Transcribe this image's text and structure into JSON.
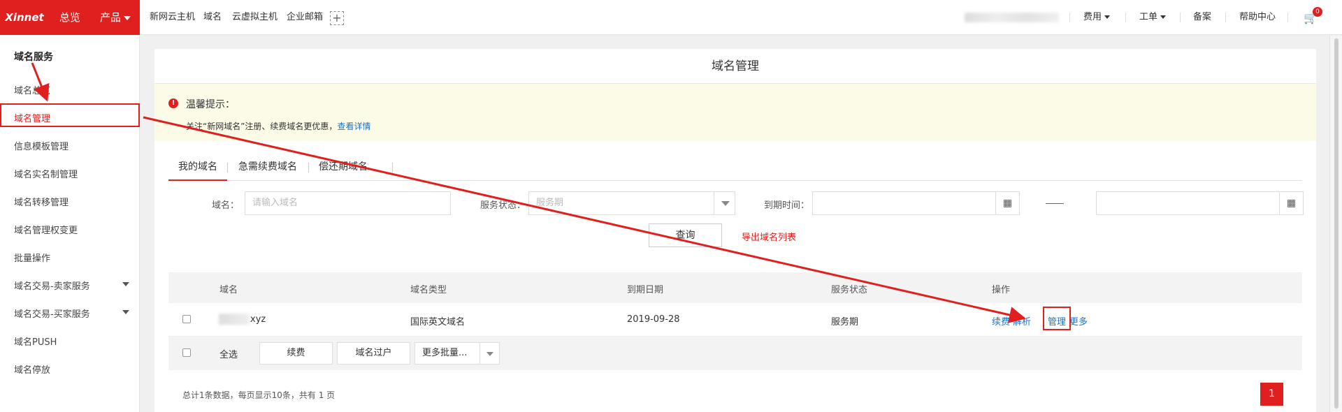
{
  "topbar": {
    "logo": "Xinnet",
    "nav_overview": "总览",
    "nav_products": "产品",
    "quick_links": [
      "新网云主机",
      "域名",
      "云虚拟主机",
      "企业邮箱"
    ],
    "add_icon": "+",
    "fees": "费用",
    "ticket": "工单",
    "record": "备案",
    "help": "帮助中心",
    "cart_count": "0"
  },
  "sidebar": {
    "title": "域名服务",
    "items": [
      {
        "label": "域名总览"
      },
      {
        "label": "域名管理"
      },
      {
        "label": "信息模板管理"
      },
      {
        "label": "域名实名制管理"
      },
      {
        "label": "域名转移管理"
      },
      {
        "label": "域名管理权变更"
      },
      {
        "label": "批量操作"
      },
      {
        "label": "域名交易-卖家服务"
      },
      {
        "label": "域名交易-买家服务"
      },
      {
        "label": "域名PUSH"
      },
      {
        "label": "域名停放"
      }
    ]
  },
  "main": {
    "title": "域名管理",
    "notice": {
      "icon": "!",
      "title": "温馨提示：",
      "text": "关注“新网域名”注册、续费域名更优惠，",
      "link": "查看详情"
    },
    "tabs": [
      "我的域名",
      "急需续费域名",
      "偿还期域名"
    ],
    "filters": {
      "domain_label": "域名：",
      "domain_placeholder": "请输入域名",
      "status_label": "服务状态：",
      "status_value": "服务期",
      "expire_label": "到期时间："
    },
    "query_button": "查询",
    "export_link": "导出域名列表",
    "table": {
      "columns": [
        "域名",
        "域名类型",
        "到期日期",
        "服务状态",
        "操作"
      ],
      "rows": [
        {
          "domain_suffix": "xyz",
          "type": "国际英文域名",
          "expire": "2019-09-28",
          "status": "服务期",
          "ops": [
            "续费",
            "解析",
            "管理",
            "更多"
          ]
        }
      ]
    },
    "footer": {
      "select_all": "全选",
      "renew": "续费",
      "transfer": "域名过户",
      "more_batch": "更多批量..."
    },
    "summary": "总计1条数据，每页显示10条，共有 1 页",
    "page": "1"
  }
}
